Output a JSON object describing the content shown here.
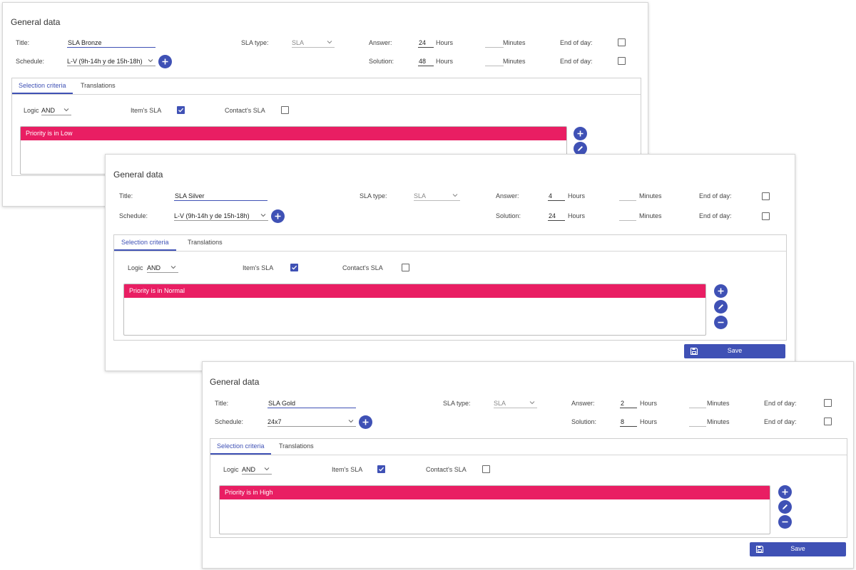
{
  "common": {
    "section_title": "General data",
    "title_label": "Title:",
    "schedule_label": "Schedule:",
    "sla_type_label": "SLA type:",
    "answer_label": "Answer:",
    "solution_label": "Solution:",
    "hours_label": "Hours",
    "minutes_label": "Minutes",
    "end_of_day_label": "End of day:",
    "tab_selection": "Selection criteria",
    "tab_translations": "Translations",
    "logic_label": "Logic",
    "items_sla_label": "Item's SLA",
    "contacts_sla_label": "Contact's SLA",
    "save_label": "Save"
  },
  "panels": [
    {
      "title_value": "SLA Bronze",
      "schedule_value": "L-V (9h-14h y de 15h-18h)",
      "sla_type_value": "SLA",
      "answer_hours": "24",
      "solution_hours": "48",
      "logic_value": "AND",
      "items_sla_checked": true,
      "contacts_sla_checked": false,
      "criteria_row": "Priority is in Low",
      "colors": {
        "accent": "#3f51b5",
        "criteria": "#e91e63"
      }
    },
    {
      "title_value": "SLA Silver",
      "schedule_value": "L-V (9h-14h y de 15h-18h)",
      "sla_type_value": "SLA",
      "answer_hours": "4",
      "solution_hours": "24",
      "logic_value": "AND",
      "items_sla_checked": true,
      "contacts_sla_checked": false,
      "criteria_row": "Priority is in Normal",
      "colors": {
        "accent": "#3f51b5",
        "criteria": "#e91e63"
      }
    },
    {
      "title_value": "SLA Gold",
      "schedule_value": "24x7",
      "sla_type_value": "SLA",
      "answer_hours": "2",
      "solution_hours": "8",
      "logic_value": "AND",
      "items_sla_checked": true,
      "contacts_sla_checked": false,
      "criteria_row": "Priority is in High",
      "colors": {
        "accent": "#3f51b5",
        "criteria": "#e91e63"
      }
    }
  ]
}
